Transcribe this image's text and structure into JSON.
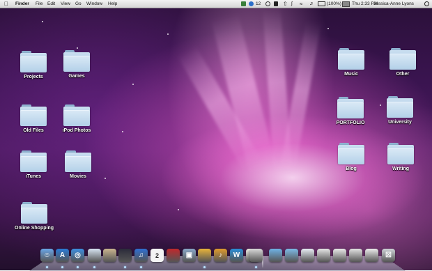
{
  "menubar": {
    "apple_icon": "apple-icon",
    "app_name": "Finder",
    "menus": [
      "File",
      "Edit",
      "View",
      "Go",
      "Window",
      "Help"
    ],
    "status_badge": "12",
    "battery": "(100%)",
    "clock": "Thu 2:33 PM",
    "user": "Jessica-Anne Lyons",
    "status_icons": [
      "script-icon",
      "messenger-icon",
      "time-machine-icon",
      "bluetooth-icon",
      "wifi-icon",
      "volume-icon",
      "battery-icon",
      "spotlight-icon"
    ]
  },
  "desktop": {
    "left_icons": [
      {
        "label": "Projects"
      },
      {
        "label": "Games"
      },
      {
        "label": "Old Files"
      },
      {
        "label": "iPod Photos"
      },
      {
        "label": "iTunes"
      },
      {
        "label": "Movies"
      },
      {
        "label": "Online Shopping"
      }
    ],
    "right_icons": [
      {
        "label": "Music"
      },
      {
        "label": "Other"
      },
      {
        "label": "PORTFOLIO"
      },
      {
        "label": "University"
      },
      {
        "label": "Blog"
      },
      {
        "label": "Writing"
      }
    ]
  },
  "dock": {
    "items": [
      {
        "name": "finder-icon",
        "color": "#6aa6e8"
      },
      {
        "name": "app-store-icon",
        "color": "#2a7bd6"
      },
      {
        "name": "safari-icon",
        "color": "#3c8fe0"
      },
      {
        "name": "mail-icon",
        "color": "#d7e4f2"
      },
      {
        "name": "contacts-icon",
        "color": "#c9b58f"
      },
      {
        "name": "dashboard-icon",
        "color": "#2b2b3a"
      },
      {
        "name": "itunes-icon",
        "color": "#2f6fd1"
      },
      {
        "name": "ical-icon",
        "color": "#f4f4f4"
      },
      {
        "name": "photo-booth-icon",
        "color": "#c0282c"
      },
      {
        "name": "iphoto-icon",
        "color": "#8aa8c8"
      },
      {
        "name": "imovie-icon",
        "color": "#e8b43a"
      },
      {
        "name": "garageband-icon",
        "color": "#e09b2e"
      },
      {
        "name": "word-icon",
        "color": "#2a8ed8"
      },
      {
        "name": "textedit-icon",
        "color": "#f0efe6"
      },
      {
        "name": "preview-icon",
        "color": "#d9d9d9"
      },
      {
        "name": "applications-stack-icon",
        "color": "#6fb2e6"
      },
      {
        "name": "documents-stack-icon",
        "color": "#7dbbe8"
      },
      {
        "name": "downloads-stack-icon",
        "color": "#e8eef5"
      },
      {
        "name": "window-1-icon",
        "color": "#e6e6e6"
      },
      {
        "name": "window-2-icon",
        "color": "#eaeaea"
      },
      {
        "name": "window-3-icon",
        "color": "#e2e2e2"
      },
      {
        "name": "window-4-icon",
        "color": "#ececec"
      },
      {
        "name": "trash-icon",
        "color": "#cfd3d8"
      }
    ],
    "calendar_day": "2"
  }
}
